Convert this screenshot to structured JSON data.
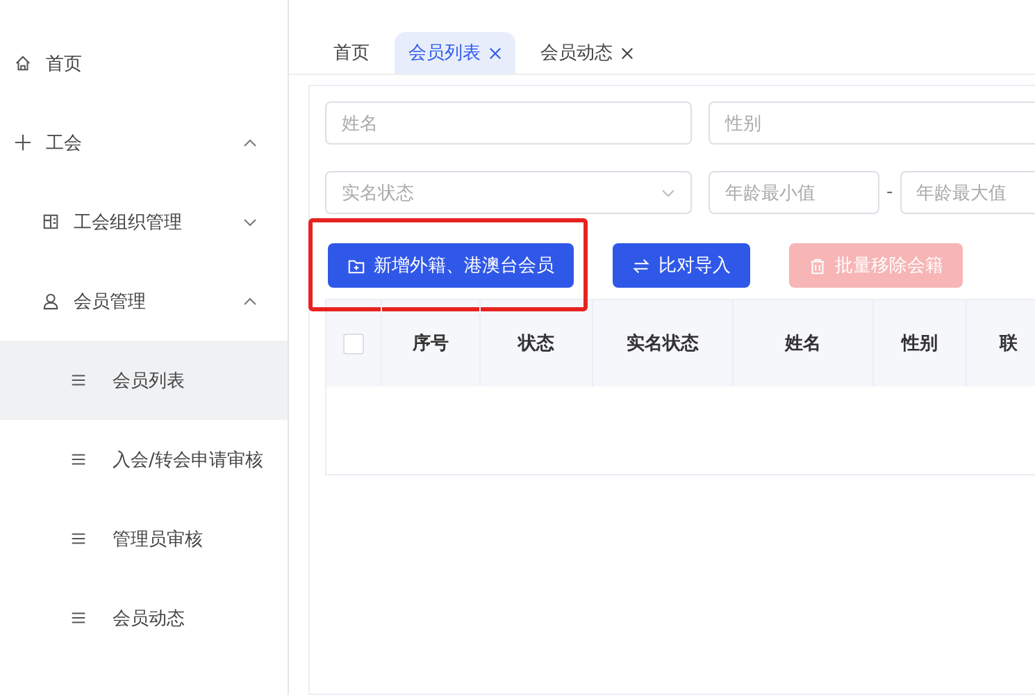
{
  "sidebar": {
    "items": [
      {
        "label": "首页",
        "selected": false
      },
      {
        "label": "工会",
        "expanded": true,
        "selected": false,
        "children": [
          {
            "label": "工会组织管理",
            "expanded": false,
            "selected": false
          },
          {
            "label": "会员管理",
            "expanded": true,
            "selected": false,
            "children": [
              {
                "label": "会员列表",
                "selected": true
              },
              {
                "label": "入会/转会申请审核",
                "selected": false
              },
              {
                "label": "管理员审核",
                "selected": false
              },
              {
                "label": "会员动态",
                "selected": false
              }
            ]
          }
        ]
      }
    ]
  },
  "tabs": [
    {
      "label": "首页",
      "selected": false,
      "closable": false
    },
    {
      "label": "会员列表",
      "selected": true,
      "closable": true
    },
    {
      "label": "会员动态",
      "selected": false,
      "closable": true
    }
  ],
  "filters": [
    [
      {
        "kind": "input",
        "placeholder": "姓名"
      },
      {
        "kind": "input",
        "placeholder": "性别"
      }
    ],
    [
      {
        "kind": "select",
        "placeholder": "实名状态"
      },
      {
        "kind": "range",
        "placeholder": "年龄最小值",
        "separator": "-",
        "placeholder_to": "年龄最大值"
      }
    ]
  ],
  "buttons": [
    {
      "label": "新增外籍、港澳台会员",
      "disabled": false,
      "highlighted": true
    },
    {
      "label": "比对导入",
      "disabled": false,
      "highlighted": false
    },
    {
      "label": "批量移除会籍",
      "disabled": true,
      "highlighted": false
    }
  ],
  "table": {
    "select_all_checked": false,
    "columns": [
      "序号",
      "状态",
      "实名状态",
      "姓名",
      "性别",
      "联"
    ]
  }
}
